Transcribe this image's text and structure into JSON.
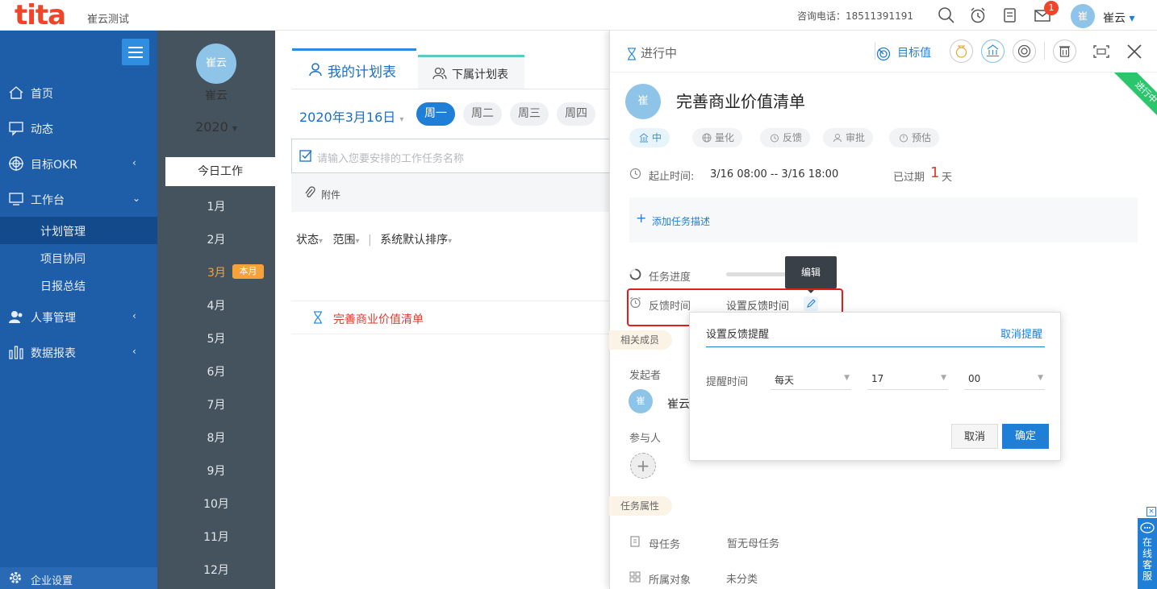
{
  "brand": {
    "logo": "tita",
    "company": "崔云测试"
  },
  "header": {
    "phone": "咨询电话：18511391191",
    "badge": "1",
    "avatar": "崔",
    "user": "崔云",
    "user_caret": "▾"
  },
  "sidebar": {
    "items": [
      {
        "label": "首页"
      },
      {
        "label": "动态"
      },
      {
        "label": "目标OKR",
        "chevron": "‹"
      },
      {
        "label": "工作台",
        "chevron": "⌄"
      },
      {
        "label": "人事管理",
        "chevron": "‹"
      },
      {
        "label": "数据报表",
        "chevron": "‹"
      }
    ],
    "sub": [
      {
        "label": "计划管理"
      },
      {
        "label": "项目协同"
      },
      {
        "label": "日报总结"
      }
    ],
    "settings": "企业设置"
  },
  "months": {
    "avatar": "崔云",
    "name": "崔云",
    "year": "2020",
    "year_caret": "▾",
    "today": "今日工作",
    "list": [
      "1月",
      "2月",
      "3月",
      "4月",
      "5月",
      "6月",
      "7月",
      "8月",
      "9月",
      "10月",
      "11月",
      "12月"
    ],
    "current_badge": "本月"
  },
  "plan": {
    "tab_mine": "我的计划表",
    "tab_sub": "下属计划表",
    "date": "2020年3月16日",
    "date_caret": "▾",
    "days": [
      "周一",
      "周二",
      "周三",
      "周四"
    ],
    "input_placeholder": "请输入您要安排的工作任务名称",
    "attach": "附件",
    "filters": [
      "状态",
      "范围",
      "|",
      "系统默认排序"
    ],
    "filter_caret": "▾",
    "task": "完善商业价值清单"
  },
  "detail": {
    "status": "进行中",
    "target_link": "目标值",
    "ribbon": "进行中",
    "avatar": "崔",
    "title": "完善商业价值清单",
    "chips": [
      "中",
      "量化",
      "反馈",
      "审批",
      "预估"
    ],
    "time_label": "起止时间:",
    "time_value": "3/16 08:00 -- 3/16 18:00",
    "overdue_prefix": "已过期",
    "overdue_num": "1",
    "overdue_suffix": "天",
    "add_desc": "添加任务描述",
    "plus": "+",
    "progress_label": "任务进度",
    "feedback_label": "反馈时间",
    "feedback_value": "设置反馈时间",
    "tooltip": "编辑",
    "members_section": "相关成员",
    "initiator_label": "发起者",
    "initiator_avatar": "崔",
    "initiator_name": "崔云",
    "participants_label": "参与人",
    "attrs_section": "任务属性",
    "parent_label": "母任务",
    "parent_value": "暂无母任务",
    "object_label": "所属对象",
    "object_value": "未分类"
  },
  "popup": {
    "title": "设置反馈提醒",
    "cancel_reminder": "取消提醒",
    "remind_label": "提醒时间",
    "freq": "每天",
    "hour": "17",
    "minute": "00",
    "arrow": "▼",
    "cancel": "取消",
    "ok": "确定"
  },
  "service": {
    "close": "×",
    "label": "在线客服"
  }
}
